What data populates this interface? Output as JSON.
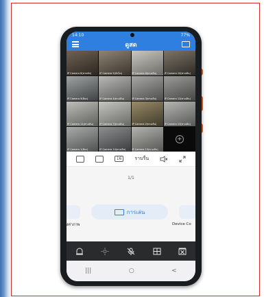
{
  "statusbar": {
    "time": "14:10",
    "battery": "77%"
  },
  "appbar": {
    "title": "ดูสด",
    "menu_icon": "menu-icon",
    "screens_icon": "multi-screen-icon"
  },
  "cameras": [
    {
      "label": "IP Camera 8(ชานพัก)",
      "colors": [
        "#6e6253",
        "#2c2620"
      ]
    },
    {
      "label": "IP Camera 5(บันได)",
      "colors": [
        "#8e8476",
        "#3a342c"
      ]
    },
    {
      "label": "IP Camera 6(ทางเดิน)",
      "colors": [
        "#c9c7c1",
        "#6b6a66"
      ]
    },
    {
      "label": "IP Camera 10(ทางเดิน)",
      "colors": [
        "#7c7568",
        "#2d2a25"
      ]
    },
    {
      "label": "IP Camera 9(ห้อง)",
      "colors": [
        "#9fa3a2",
        "#3f4243"
      ]
    },
    {
      "label": "IP Camera 4(ทางเดิน)",
      "colors": [
        "#b8b9b6",
        "#5a5b58"
      ]
    },
    {
      "label": "IP Camera 3(ทางเดิน)",
      "colors": [
        "#a7a7a4",
        "#4e4e4b"
      ]
    },
    {
      "label": "IP Camera 12(ทางเดิน)",
      "colors": [
        "#9c9d9a",
        "#454543"
      ]
    },
    {
      "label": "IP Camera 11(ทางเดิน)",
      "colors": [
        "#bdbdb9",
        "#5f5f5b"
      ]
    },
    {
      "label": "IP Camera 7(ทางเดิน)",
      "colors": [
        "#c5c5c1",
        "#686864"
      ]
    },
    {
      "label": "IP Camera 2(ทางเดิน)",
      "colors": [
        "#9a8a68",
        "#3e3a2a"
      ]
    },
    {
      "label": "IP Camera 13(ทางเดิน)",
      "colors": [
        "#b5b6b2",
        "#575855"
      ]
    },
    {
      "label": "IP Camera 1(ห้อง)",
      "colors": [
        "#a9abaa",
        "#4f5150"
      ]
    },
    {
      "label": "IP Camera 14(ทางเดิน)",
      "colors": [
        "#8c8f90",
        "#3a3c3d"
      ]
    },
    {
      "label": "IP Camera 15(ทางเดิน)",
      "colors": [
        "#b2b3af",
        "#555652"
      ]
    }
  ],
  "toolbar": {
    "split_count": "16",
    "quality_label": "ราบรื่น",
    "icons": [
      "snapshot-icon",
      "record-icon",
      "split-screen-icon",
      "mute-icon",
      "fullscreen-icon"
    ]
  },
  "page_indicator": "1/1",
  "controls": {
    "left_label": "ตั้งค่าภาพ",
    "playback_label": "การเล่น",
    "right_label": "Device Co"
  },
  "bottombar": {
    "icons": [
      "alarm-bell-icon",
      "ptz-icon",
      "mic-off-icon",
      "image-settings-icon",
      "close-stream-icon"
    ]
  },
  "navbar": {
    "recent": "|||",
    "home": "○",
    "back": "<"
  }
}
